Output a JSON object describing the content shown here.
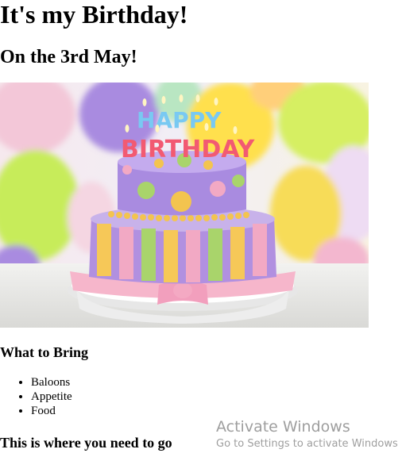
{
  "page": {
    "title": "It's my Birthday!",
    "subtitle": "On the 3rd May!",
    "image": {
      "name": "birthday-cake-image",
      "topper_line1": "HAPPY",
      "topper_line2": "BIRTHDAY"
    },
    "bring_section": {
      "heading": "What to Bring",
      "items": [
        "Baloons",
        "Appetite",
        "Food"
      ]
    },
    "location_heading": "This is where you need to go"
  },
  "watermark": {
    "title": "Activate Windows",
    "subtitle": "Go to Settings to activate Windows"
  }
}
